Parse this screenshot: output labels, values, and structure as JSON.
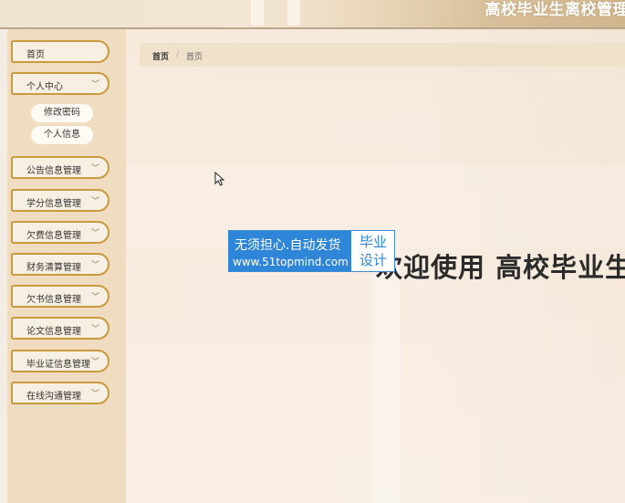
{
  "header": {
    "title": "高校毕业生离校管理"
  },
  "sidebar": {
    "items": [
      {
        "label": "首页",
        "has_chevron": false
      },
      {
        "label": "个人中心",
        "has_chevron": true,
        "children": [
          "修改密码",
          "个人信息"
        ]
      },
      {
        "label": "公告信息管理",
        "has_chevron": true
      },
      {
        "label": "学分信息管理",
        "has_chevron": true
      },
      {
        "label": "欠费信息管理",
        "has_chevron": true
      },
      {
        "label": "财务清算管理",
        "has_chevron": true
      },
      {
        "label": "欠书信息管理",
        "has_chevron": true
      },
      {
        "label": "论文信息管理",
        "has_chevron": true
      },
      {
        "label": "毕业证信息管理",
        "has_chevron": true
      },
      {
        "label": "在线沟通管理",
        "has_chevron": true
      }
    ],
    "chevron_glyph": "﹀"
  },
  "breadcrumb": {
    "home": "首页",
    "separator": "/",
    "current": "首页"
  },
  "main": {
    "welcome": "欢迎使用 高校毕业生"
  },
  "watermark": {
    "slogan": "无须担心.自动发货",
    "url": "www.51topmind.com",
    "tag_line1": "毕业",
    "tag_line2": "设计"
  },
  "colors": {
    "sidebar_bg": "#f0dcc0",
    "menu_border": "#c79b3e",
    "watermark_blue": "#2f86d8"
  }
}
